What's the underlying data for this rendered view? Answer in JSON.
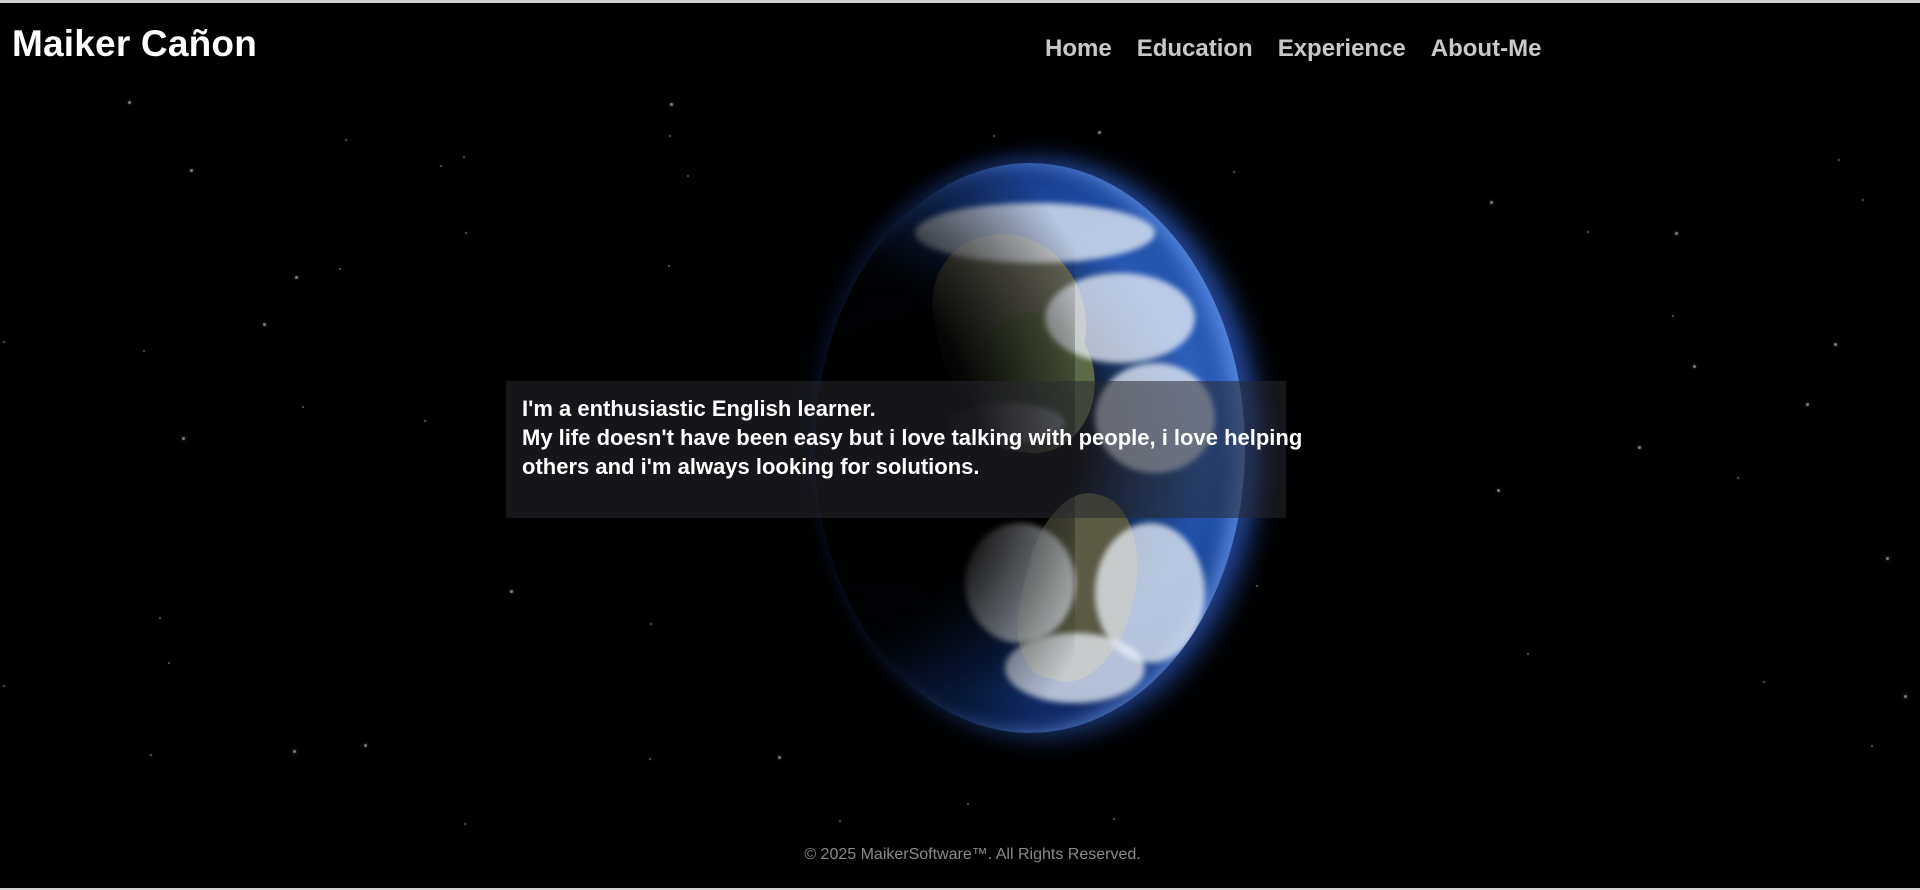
{
  "header": {
    "brand": "Maiker Cañon",
    "nav": [
      {
        "label": "Home"
      },
      {
        "label": "Education"
      },
      {
        "label": "Experience"
      },
      {
        "label": "About-Me"
      }
    ]
  },
  "hero": {
    "line1": "I'm a enthusiastic English learner.",
    "line2": "My life doesn't have been easy but i love talking with people, i love helping others and i'm always looking for solutions."
  },
  "footer": {
    "text": "© 2025 MaikerSoftware™. All Rights Reserved."
  },
  "colors": {
    "background": "#000000",
    "brand": "#ffffff",
    "nav": "#c8c8c8",
    "footer": "#8a8a8a",
    "earth_glow": "#3b6fd0"
  }
}
